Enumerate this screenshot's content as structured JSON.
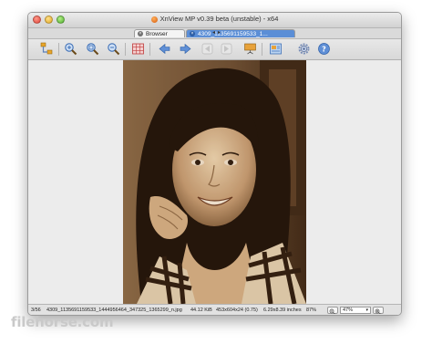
{
  "window": {
    "title": "XnView MP v0.39 beta (unstable) - x64"
  },
  "tabs": [
    {
      "label": "Browser",
      "active": false
    },
    {
      "label": "4309_1135691159533_1...",
      "active": true
    }
  ],
  "toolbar": {
    "buttons": [
      {
        "name": "organize-icon"
      },
      {
        "name": "zoom-in-icon"
      },
      {
        "name": "zoom-fit-icon"
      },
      {
        "name": "zoom-out-icon"
      },
      {
        "name": "grid-icon"
      },
      {
        "name": "previous-icon"
      },
      {
        "name": "next-icon"
      },
      {
        "name": "first-icon"
      },
      {
        "name": "last-icon"
      },
      {
        "name": "slideshow-icon"
      },
      {
        "name": "image-info-icon"
      },
      {
        "name": "settings-icon"
      },
      {
        "name": "help-icon"
      }
    ]
  },
  "status": {
    "index": "3/56",
    "filename": "4309_1135691159533_1444956464_347325_1365299_n.jpg",
    "filesize": "44.12 KiB",
    "dimensions": "453x604x24 (0.75)",
    "print_size": "6.29x8.39 inches",
    "quality": "87%",
    "zoom": "47%"
  },
  "watermark": "filehorse.com",
  "colors": {
    "accent_tab": "#5b8ed6",
    "window_bg": "#ececec"
  }
}
